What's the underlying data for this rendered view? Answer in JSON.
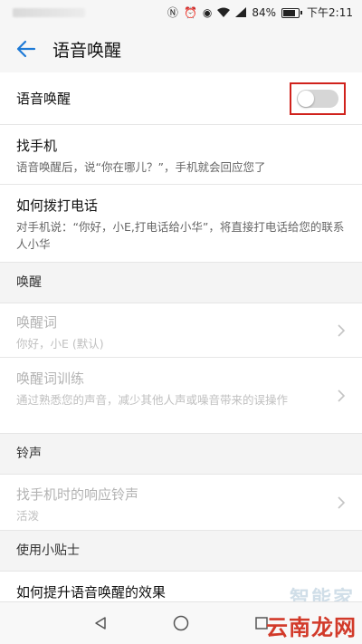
{
  "status_bar": {
    "battery": "84%",
    "time": "下午2:11"
  },
  "header": {
    "title": "语音唤醒"
  },
  "rows": {
    "voice_wake": {
      "title": "语音唤醒",
      "toggle_on": false
    },
    "find_phone": {
      "title": "找手机",
      "subtitle": "语音唤醒后，说“你在哪儿？”，手机就会回应您了"
    },
    "how_to_call": {
      "title": "如何拨打电话",
      "subtitle": "对手机说：“你好，小E,打电话给小华”，将直接打电话给您的联系人小华"
    }
  },
  "sections": {
    "wake": "唤醒",
    "ringtone": "铃声",
    "tips": "使用小贴士"
  },
  "wake_rows": {
    "wake_word": {
      "title": "唤醒词",
      "subtitle": "你好，小E (默认)"
    },
    "wake_training": {
      "title": "唤醒词训练",
      "subtitle": "通过熟悉您的声音，减少其他人声或噪音带来的误操作"
    }
  },
  "ringtone_rows": {
    "response_tone": {
      "title": "找手机时的响应铃声",
      "subtitle": "活泼"
    }
  },
  "tips_rows": {
    "improve": {
      "title": "如何提升语音唤醒的效果"
    }
  },
  "watermark": {
    "text": "云南龙网",
    "faint": "智能家"
  },
  "colors": {
    "accent": "#1e7ad6",
    "highlight_box": "#d0221c"
  }
}
